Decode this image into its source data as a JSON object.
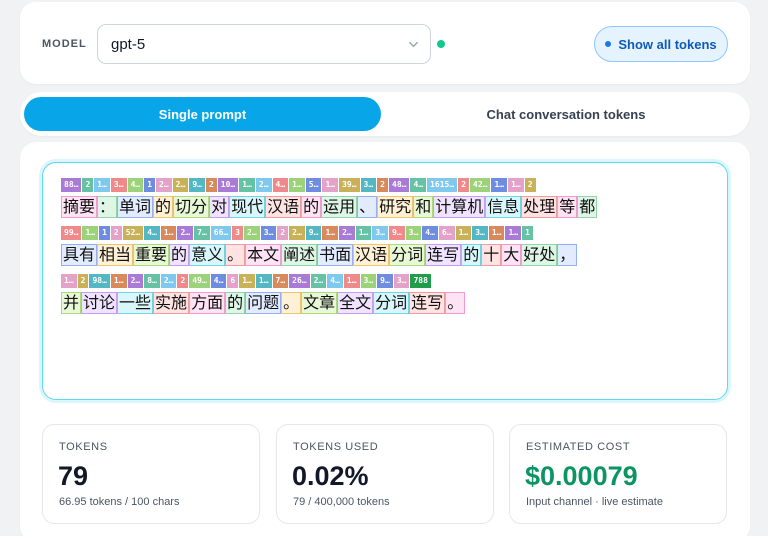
{
  "model": {
    "label": "MODEL",
    "selected": "gpt-5",
    "show_tokens_label": "Show all tokens"
  },
  "tabs": [
    {
      "label": "Single prompt",
      "active": true
    },
    {
      "label": "Chat conversation tokens",
      "active": false
    }
  ],
  "token_lines": [
    {
      "ids": [
        "88…",
        "2",
        "1…",
        "3…",
        "4…",
        "1",
        "2…",
        "2…",
        "9…",
        "2",
        "10…",
        "1…",
        "2…",
        "4…",
        "1…",
        "5…",
        "1…",
        "39…",
        "3…",
        "2",
        "48…",
        "4…",
        "1615…",
        "2",
        "42…",
        "1…",
        "1…",
        "2"
      ],
      "tokens": [
        "摘要",
        "：",
        "单词",
        "的",
        "切分",
        "对",
        "现代",
        "汉语",
        "的",
        "运用",
        "、",
        "研究",
        "和",
        "计算机",
        "信息",
        "处理",
        "等",
        "都"
      ]
    },
    {
      "ids": [
        "99…",
        "1…",
        "1",
        "2",
        "52…",
        "4…",
        "1…",
        "2…",
        "7…",
        "66…",
        "3",
        "2…",
        "3…",
        "2",
        "2…",
        "9…",
        "1…",
        "2…",
        "1…",
        "3…",
        "9…",
        "3…",
        "4…",
        "6…",
        "1…",
        "3…",
        "1…",
        "1…",
        "1"
      ],
      "tokens": [
        "具有",
        "相当",
        "重要",
        "的",
        "意义",
        "。",
        "本文",
        "阐述",
        "书面",
        "汉语",
        "分词",
        "连写",
        "的",
        "十",
        "大",
        "好处",
        "，"
      ]
    },
    {
      "ids": [
        "1…",
        "2",
        "98…",
        "1…",
        "2…",
        "8…",
        "2…",
        "2",
        "49…",
        "4…",
        "6",
        "1…",
        "1…",
        "7…",
        "26…",
        "2…",
        "4…",
        "1…",
        "3…",
        "9…",
        "3…",
        "788"
      ],
      "tokens": [
        "并",
        "讨论",
        "一些",
        "实施",
        "方面",
        "的",
        "问题",
        "。",
        "文章",
        "全文",
        "分词",
        "连写",
        "。"
      ]
    }
  ],
  "stats": {
    "tokens": {
      "label": "TOKENS",
      "value": "79",
      "sub": "66.95 tokens / 100 chars"
    },
    "used": {
      "label": "TOKENS USED",
      "value": "0.02%",
      "sub": "79 / 400,000 tokens"
    },
    "cost": {
      "label": "ESTIMATED COST",
      "value": "$0.00079",
      "sub": "Input channel · live estimate"
    }
  },
  "colors": {
    "accent": "#08a6e8",
    "status_green": "#10c98a",
    "cost_green": "#0d9463"
  }
}
